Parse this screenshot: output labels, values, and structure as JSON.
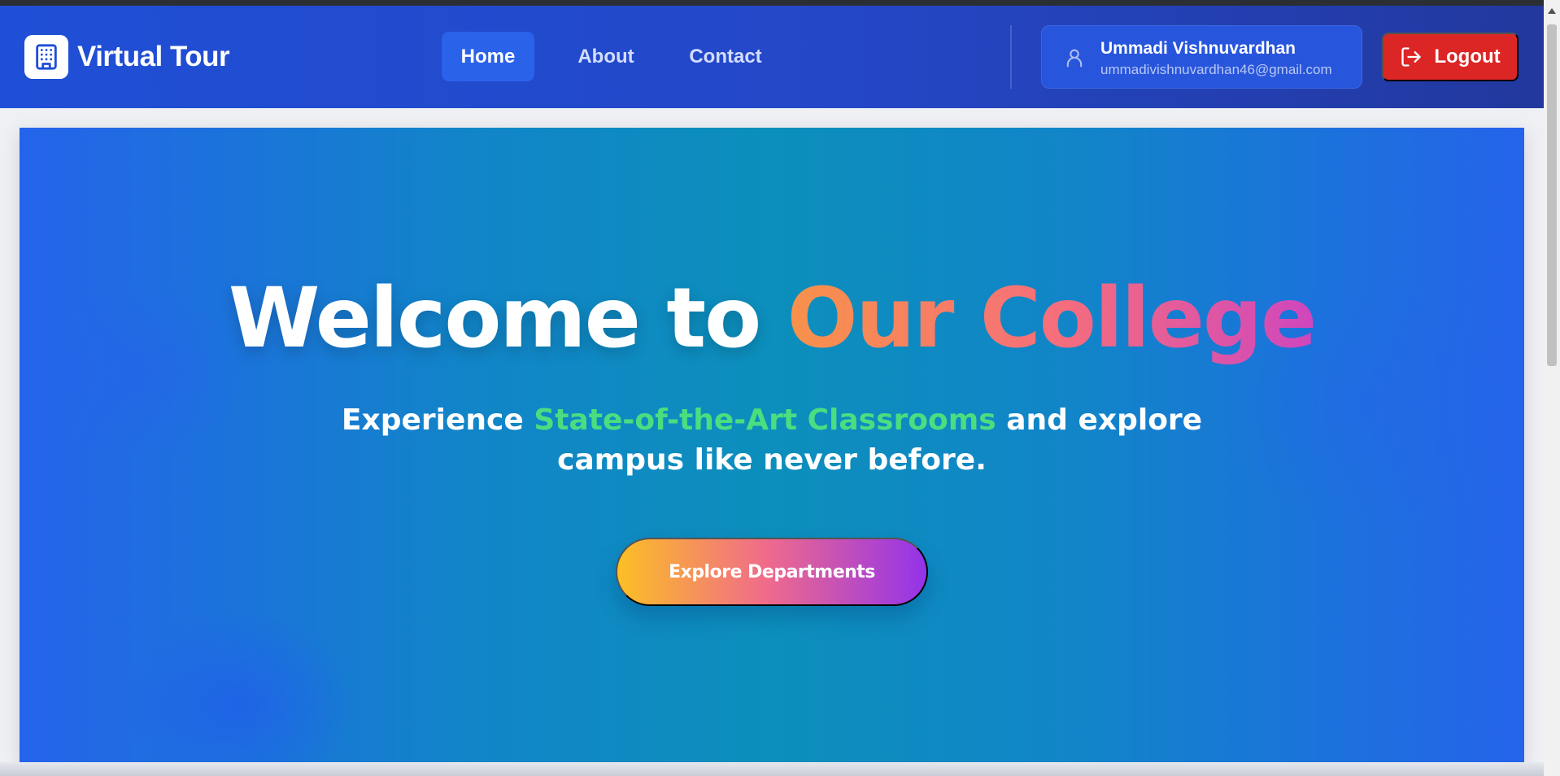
{
  "navbar": {
    "brand": {
      "icon": "building-icon",
      "title": "Virtual Tour"
    },
    "links": [
      {
        "label": "Home",
        "active": true
      },
      {
        "label": "About",
        "active": false
      },
      {
        "label": "Contact",
        "active": false
      }
    ],
    "user": {
      "icon": "user-icon",
      "name": "Ummadi Vishnuvardhan",
      "email": "ummadivishnuvardhan46@gmail.com"
    },
    "logout": {
      "icon": "logout-icon",
      "label": "Logout"
    }
  },
  "hero": {
    "title_prefix": "Welcome to",
    "title_highlight": "Our College",
    "subtitle_prefix": "Experience",
    "subtitle_highlight": "State-of-the-Art Classrooms",
    "subtitle_middle": "and explore",
    "subtitle_line2": "campus like never before.",
    "cta_label": "Explore Departments"
  },
  "colors": {
    "navbar": "#2447c7",
    "active_link": "#2a63ea",
    "logout": "#dc2626",
    "hero_base": "#2563eb",
    "subtitle_accent": "#4ade80"
  }
}
